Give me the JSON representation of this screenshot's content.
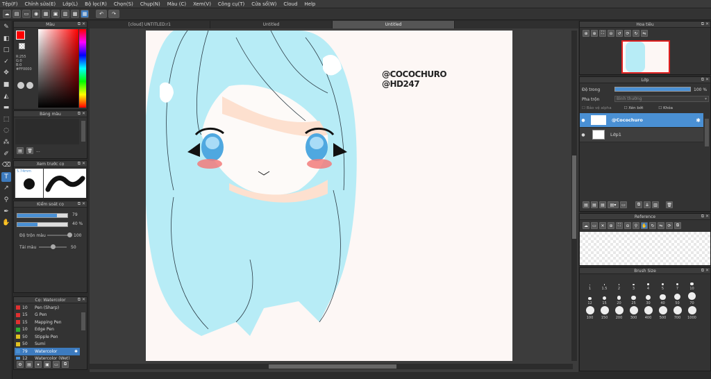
{
  "menu": [
    "Tệp(F)",
    "Chỉnh sửa(E)",
    "Lớp(L)",
    "Bộ lọc(R)",
    "Chọn(S)",
    "Chụp(N)",
    "Màu (C)",
    "Xem(V)",
    "Công cụ(T)",
    "Cửa sổ(W)",
    "Cloud",
    "Help"
  ],
  "color_panel": {
    "title": "Màu",
    "r": "R:255",
    "g": "G:0",
    "b": "B:0",
    "hex": "#FF0000",
    "primary": "#ff0000"
  },
  "palette_panel": {
    "title": "Bảng màu",
    "more": "..."
  },
  "brush_preview": {
    "title": "Xem trước cọ",
    "size": "5.74mm"
  },
  "brush_control": {
    "title": "Kiểm soát cọ",
    "size_value": "79",
    "opacity_value": "40 %",
    "blend_label": "Độ trộn màu",
    "blend_value": "100",
    "refill_label": "Tải màu",
    "refill_value": "50",
    "size_frac": 0.79,
    "opacity_frac": 0.4,
    "blend_frac": 1.0,
    "refill_frac": 0.5
  },
  "brush_list": {
    "title": "Cọ: Watercolor",
    "items": [
      {
        "num": "10",
        "name": "Pen (Sharp)",
        "color": "#e03030"
      },
      {
        "num": "15",
        "name": "G Pen",
        "color": "#e03030"
      },
      {
        "num": "15",
        "name": "Mapping Pen",
        "color": "#e03030"
      },
      {
        "num": "10",
        "name": "Edge Pen",
        "color": "#30b030"
      },
      {
        "num": "50",
        "name": "Stipple Pen",
        "color": "#e0c020"
      },
      {
        "num": "50",
        "name": "Sumi",
        "color": "#e0c020"
      },
      {
        "num": "79",
        "name": "Watercolor",
        "color": "#4a90d4"
      },
      {
        "num": "12",
        "name": "Watercolor (Wet)",
        "color": "#4a90d4"
      }
    ]
  },
  "tabs": [
    "[cloud] UNTITLED:r1",
    "Untitled",
    "Untitled"
  ],
  "artwork": {
    "signature_line1": "@COCOCHURO",
    "signature_line2": "@HD247"
  },
  "navigator": {
    "title": "Hoa tiêu"
  },
  "layer_panel": {
    "title": "Lớp",
    "opacity_label": "Độ trong",
    "opacity_value": "100 %",
    "opacity_frac": 1.0,
    "blend_label": "Pha trộn",
    "blend_value": "Bình thường",
    "protect_alpha": "Bảo vệ alpha",
    "clipping": "Xén bớt",
    "lock": "Khóa",
    "layers": [
      {
        "name": "@Cocochuro",
        "selected": true
      },
      {
        "name": "Lớp1",
        "selected": false
      }
    ]
  },
  "reference_panel": {
    "title": "Reference"
  },
  "brush_size_panel": {
    "title": "Brush Size",
    "sizes": [
      "1",
      "1.5",
      "2",
      "3",
      "4",
      "5",
      "7",
      "10",
      "12",
      "15",
      "20",
      "25",
      "30",
      "40",
      "50",
      "70",
      "100",
      "150",
      "200",
      "300",
      "400",
      "500",
      "700",
      "1000"
    ]
  },
  "colors": {
    "accent": "#3d7bbf",
    "hair": "#b7ecf6",
    "skin": "#fde0cf"
  }
}
